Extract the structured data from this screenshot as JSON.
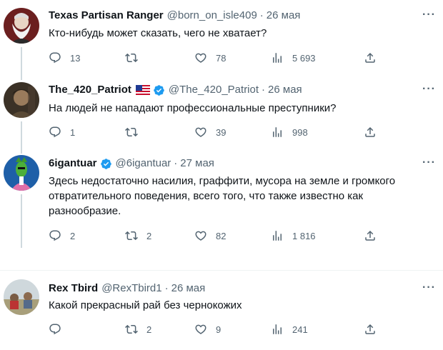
{
  "tweets": [
    {
      "name": "Texas Partisan Ranger",
      "handle": "@born_on_isle409",
      "dot": "·",
      "date": "26 мая",
      "text": "Кто-нибудь может сказать, чего не хватает?",
      "replies": "13",
      "retweets": "",
      "likes": "78",
      "views": "5 693",
      "verified": false,
      "flag": false,
      "more": "···"
    },
    {
      "name": "The_420_Patriot",
      "handle": "@The_420_Patriot",
      "dot": "·",
      "date": "26 мая",
      "text": "На людей не нападают профессиональные преступники?",
      "replies": "1",
      "retweets": "",
      "likes": "39",
      "views": "998",
      "verified": true,
      "flag": true,
      "more": "···"
    },
    {
      "name": "6igantuar",
      "handle": "@6igantuar",
      "dot": "·",
      "date": "27 мая",
      "text": "Здесь недостаточно насилия, граффити, мусора на земле и громкого отвратительного поведения, всего того, что также известно как разнообразие.",
      "replies": "2",
      "retweets": "2",
      "likes": "82",
      "views": "1 816",
      "verified": true,
      "flag": false,
      "more": "···"
    },
    {
      "name": "Rex Tbird",
      "handle": "@RexTbird1",
      "dot": "·",
      "date": "26 мая",
      "text": "Какой прекрасный рай без чернокожих",
      "replies": "",
      "retweets": "2",
      "likes": "9",
      "views": "241",
      "verified": false,
      "flag": false,
      "more": "···"
    }
  ],
  "icons": {
    "reply": "reply-icon",
    "retweet": "retweet-icon",
    "like": "heart-icon",
    "views": "views-icon",
    "share": "share-icon",
    "more": "more-icon",
    "verified": "verified-badge-icon",
    "flag": "us-flag-icon"
  },
  "colors": {
    "text_primary": "#0f1419",
    "text_secondary": "#536471",
    "verified_blue": "#1d9bf0",
    "thread_line": "#cfd9de",
    "separator": "#eff3f4"
  }
}
